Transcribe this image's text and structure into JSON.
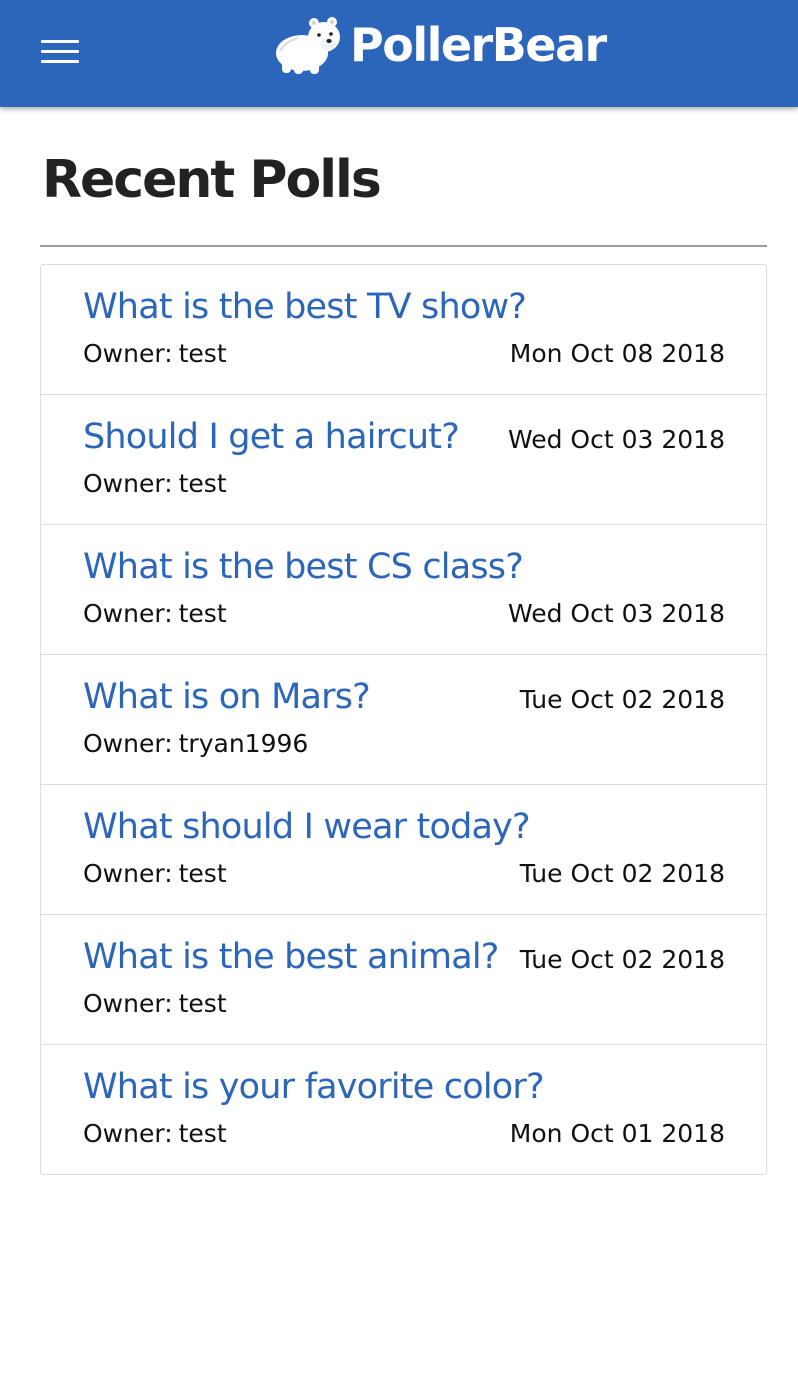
{
  "app": {
    "brand_name": "PollerBear",
    "colors": {
      "primary": "#2c66bb",
      "heading": "#222222",
      "text": "#111111",
      "divider": "#dddddd"
    }
  },
  "navbar": {
    "menu_icon": "hamburger-menu-icon",
    "logo_icon": "polar-bear-icon"
  },
  "main": {
    "title": "Recent Polls",
    "owner_label": "Owner:",
    "polls": [
      {
        "question": "What is the best TV show?",
        "owner": "test",
        "date": "Mon Oct 08 2018"
      },
      {
        "question": "Should I get a haircut?",
        "owner": "test",
        "date": "Wed Oct 03 2018"
      },
      {
        "question": "What is the best CS class?",
        "owner": "test",
        "date": "Wed Oct 03 2018"
      },
      {
        "question": "What is on Mars?",
        "owner": "tryan1996",
        "date": "Tue Oct 02 2018"
      },
      {
        "question": "What should I wear today?",
        "owner": "test",
        "date": "Tue Oct 02 2018"
      },
      {
        "question": "What is the best animal?",
        "owner": "test",
        "date": "Tue Oct 02 2018"
      },
      {
        "question": "What is your favorite color?",
        "owner": "test",
        "date": "Mon Oct 01 2018"
      }
    ]
  }
}
